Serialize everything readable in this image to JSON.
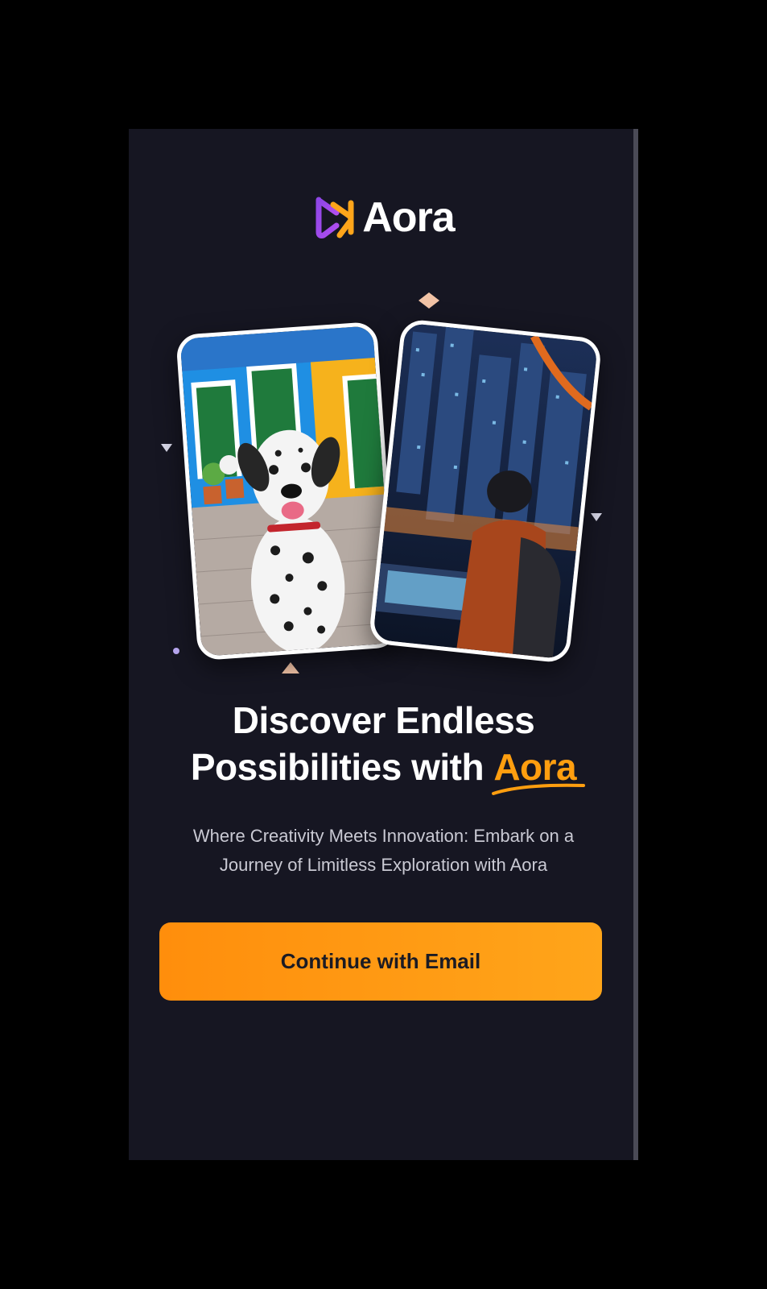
{
  "app": {
    "name": "Aora"
  },
  "logo": {
    "text": "Aora",
    "icon": "aora-logo-mark",
    "colors": {
      "purple": "#8f46e6",
      "orange": "#ffa51a"
    }
  },
  "hero": {
    "cards": [
      {
        "subject": "dalmatian dog in colorful street"
      },
      {
        "subject": "person at laptop in futuristic city"
      }
    ]
  },
  "headline": {
    "line1": "Discover Endless",
    "line2_prefix": "Possibilities with ",
    "brand": "Aora"
  },
  "subtext": "Where Creativity Meets Innovation: Embark on a Journey of Limitless Exploration with Aora",
  "cta": {
    "label": "Continue with Email"
  },
  "colors": {
    "background": "#161622",
    "accent": "#ff9e0f",
    "text": "#ffffff",
    "muted_text": "#c9c9d3"
  }
}
